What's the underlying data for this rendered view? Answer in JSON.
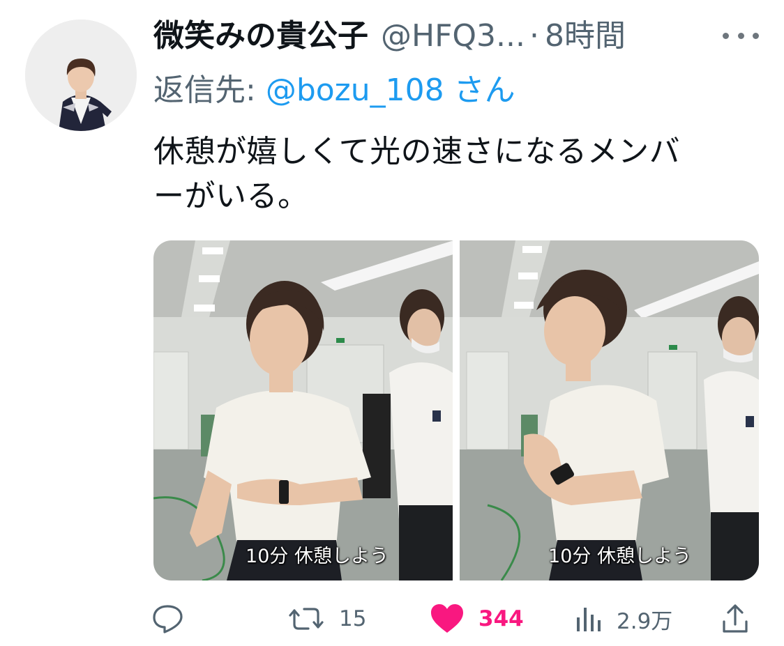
{
  "tweet": {
    "display_name": "微笑みの貴公子",
    "handle": "@HFQ3...",
    "separator": "·",
    "time": "8時間",
    "reply_label": "返信先:",
    "reply_to": "@bozu_108 さん",
    "text_line1": "休憩が嬉しくて光の速さになるメンバ",
    "text_line2": "ーがいる。"
  },
  "media": [
    {
      "caption": "10分 休憩しよう"
    },
    {
      "caption": "10分 休憩しよう"
    }
  ],
  "actions": {
    "reply": {
      "icon": "reply-icon"
    },
    "retweet": {
      "icon": "retweet-icon",
      "count": "15"
    },
    "like": {
      "icon": "heart-icon",
      "count": "344",
      "liked": true
    },
    "views": {
      "icon": "views-icon",
      "count": "2.9万"
    },
    "share": {
      "icon": "share-icon"
    }
  },
  "colors": {
    "text_primary": "#0f1419",
    "text_secondary": "#536471",
    "link": "#1d9bf0",
    "like": "#f91880"
  }
}
